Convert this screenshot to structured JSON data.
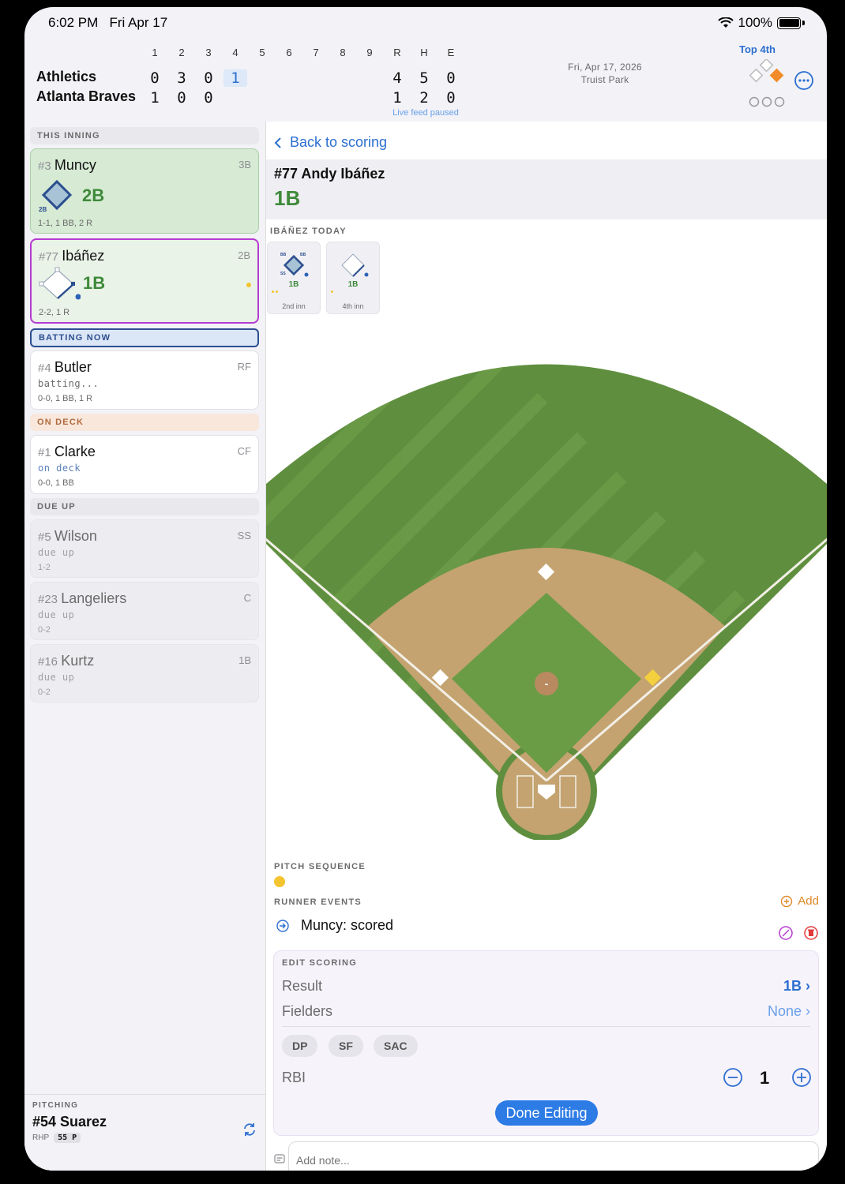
{
  "status_bar": {
    "time": "6:02 PM",
    "date": "Fri Apr 17",
    "battery": "100%"
  },
  "scoreboard": {
    "innings": [
      "1",
      "2",
      "3",
      "4",
      "5",
      "6",
      "7",
      "8",
      "9"
    ],
    "rhe_headers": [
      "R",
      "H",
      "E"
    ],
    "teams": [
      {
        "name": "Athletics",
        "innings": [
          "0",
          "3",
          "0",
          "1"
        ],
        "r": "4",
        "h": "5",
        "e": "0"
      },
      {
        "name": "Atlanta Braves",
        "innings": [
          "1",
          "0",
          "0"
        ],
        "r": "1",
        "h": "2",
        "e": "0"
      }
    ],
    "current_inning_index": 3,
    "game_date": "Fri, Apr 17, 2026",
    "venue": "Truist Park",
    "inning_label": "Top 4th",
    "live_feed": "Live feed paused"
  },
  "lineup": {
    "this_inning_label": "THIS INNING",
    "batting_now_label": "BATTING NOW",
    "on_deck_label": "ON DECK",
    "due_up_label": "DUE UP",
    "this_inning": [
      {
        "num": "#3",
        "name": "Muncy",
        "pos": "3B",
        "result": "2B",
        "base_tag": "2B",
        "stat": "1-1, 1 BB, 2 R"
      },
      {
        "num": "#77",
        "name": "Ibáñez",
        "pos": "2B",
        "result": "1B",
        "stat": "2-2, 1 R"
      }
    ],
    "batting_now": {
      "num": "#4",
      "name": "Butler",
      "pos": "RF",
      "status": "batting...",
      "stat": "0-0, 1 BB, 1 R"
    },
    "on_deck": {
      "num": "#1",
      "name": "Clarke",
      "pos": "CF",
      "status": "on deck",
      "stat": "0-0, 1 BB"
    },
    "due_up": [
      {
        "num": "#5",
        "name": "Wilson",
        "pos": "SS",
        "status": "due up",
        "stat": "1-2"
      },
      {
        "num": "#23",
        "name": "Langeliers",
        "pos": "C",
        "status": "due up",
        "stat": "0-2"
      },
      {
        "num": "#16",
        "name": "Kurtz",
        "pos": "1B",
        "status": "due up",
        "stat": "0-2"
      }
    ]
  },
  "pitching": {
    "label": "PITCHING",
    "name": "#54 Suarez",
    "hand": "RHP",
    "pitches": "55 P"
  },
  "detail": {
    "back_label": "Back to scoring",
    "batter": "#77 Andy Ibáñez",
    "result": "1B",
    "today_label": "IBÁÑEZ TODAY",
    "today": [
      {
        "result": "1B",
        "inning": "2nd inn",
        "tags": [
          "BB",
          "BB",
          "SS"
        ]
      },
      {
        "result": "1B",
        "inning": "4th inn"
      }
    ],
    "pitch_sequence_label": "PITCH SEQUENCE",
    "runner_events_label": "RUNNER EVENTS",
    "add_label": "Add",
    "runner_event": "Muncy: scored",
    "edit_scoring_label": "EDIT SCORING",
    "result_label": "Result",
    "result_value": "1B",
    "fielders_label": "Fielders",
    "fielders_value": "None",
    "chips": [
      "DP",
      "SF",
      "SAC"
    ],
    "rbi_label": "RBI",
    "rbi_value": "1",
    "done_label": "Done Editing",
    "note_placeholder": "Add note...",
    "pitcher_mound": "-"
  },
  "colors": {
    "accent": "#2d6fd0",
    "result_green": "#3f8a3a",
    "grass": "#5f8f3e",
    "infield_dirt": "#c4a370",
    "selected_border": "#b53bd1",
    "batting_now_border": "#2c4f8f",
    "ball_yellow": "#f4c430",
    "on_deck_bg": "#f9e7dc"
  }
}
